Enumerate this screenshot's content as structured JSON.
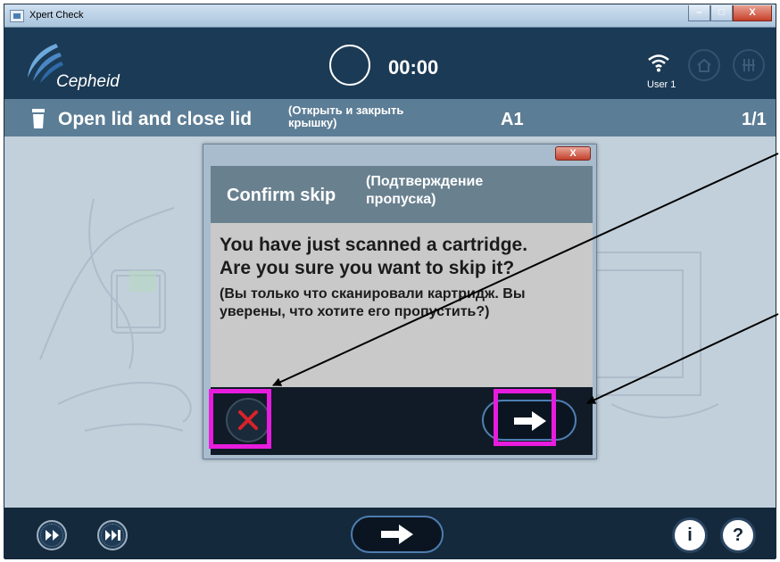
{
  "window": {
    "title": "Xpert Check",
    "controls": {
      "minimize": "–",
      "maximize": "□",
      "close": "X"
    }
  },
  "header": {
    "brand": "Cepheid",
    "timer": "00:00",
    "user": "User 1",
    "icons": [
      "wifi-icon",
      "home-icon",
      "grid-icon"
    ]
  },
  "step": {
    "title": "Open lid and close lid",
    "title_ru": "(Открыть и закрыть крышку)",
    "position": "A1",
    "count": "1/1"
  },
  "dialog": {
    "close": "X",
    "title": "Confirm skip",
    "title_ru": "(Подтверждение пропуска)",
    "message": "You have just scanned a cartridge.  Are you sure you want to skip it?",
    "message_ru": "(Вы только что сканировали картридж. Вы уверены, что хотите его пропустить?)",
    "buttons": {
      "cancel_icon": "close-x-icon",
      "confirm_icon": "arrow-right-icon"
    }
  },
  "footer": {
    "buttons": [
      "fast-forward-icon",
      "skip-next-icon",
      "arrow-right-icon"
    ],
    "info": "i",
    "help": "?"
  },
  "colors": {
    "header_bg": "#1b3a55",
    "step_bar": "#5c7d96",
    "content_bg": "#c2d0db",
    "highlight": "#e81cde",
    "cancel_red": "#d8232a"
  }
}
